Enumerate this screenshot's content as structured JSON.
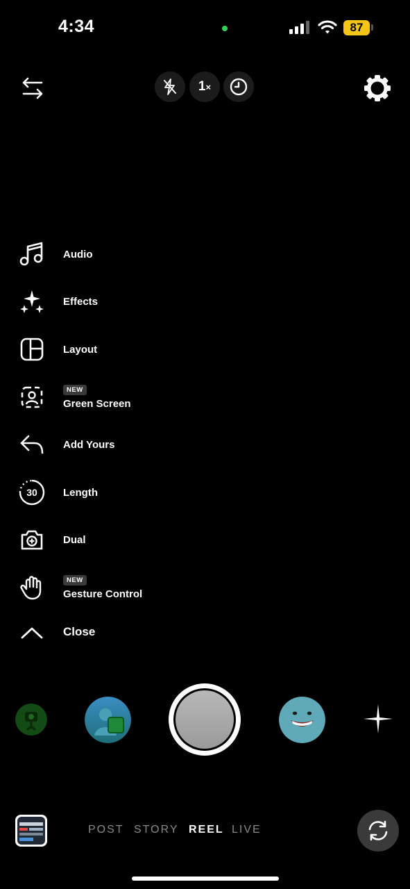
{
  "status_bar": {
    "time": "4:34",
    "battery": "87"
  },
  "top_bar": {
    "zoom": "1",
    "zoom_suffix": "×"
  },
  "menu": [
    {
      "label": "Audio",
      "icon": "music-note-icon"
    },
    {
      "label": "Effects",
      "icon": "sparkles-icon"
    },
    {
      "label": "Layout",
      "icon": "layout-grid-icon"
    },
    {
      "label": "Green Screen",
      "icon": "green-screen-icon",
      "badge": "NEW"
    },
    {
      "label": "Add Yours",
      "icon": "reply-arrow-icon"
    },
    {
      "label": "Length",
      "icon": "timer-30-icon",
      "icon_text": "30"
    },
    {
      "label": "Dual",
      "icon": "dual-camera-icon"
    },
    {
      "label": "Gesture Control",
      "icon": "hand-icon",
      "badge": "NEW"
    },
    {
      "label": "Close",
      "icon": "chevron-up-icon"
    }
  ],
  "modes": [
    "POST",
    "STORY",
    "REEL",
    "LIVE"
  ],
  "active_mode": "REEL",
  "colors": {
    "battery": "#f5c518",
    "privacy_dot": "#30d158",
    "badge": "#3a3a3a"
  }
}
